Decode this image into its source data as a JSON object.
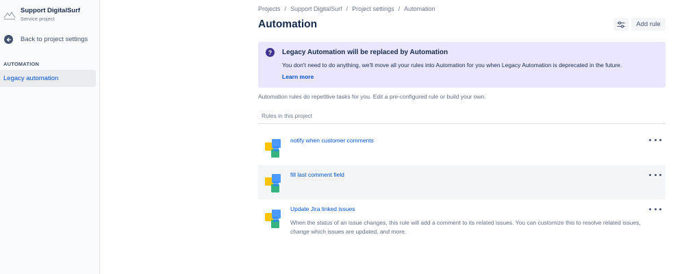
{
  "sidebar": {
    "project_name": "Support DigitalSurf",
    "project_type": "Service project",
    "back_label": "Back to project settings",
    "section_label": "AUTOMATION",
    "items": [
      {
        "label": "Legacy automation",
        "selected": true
      }
    ]
  },
  "breadcrumb": [
    {
      "label": "Projects"
    },
    {
      "label": "Support DigitalSurf"
    },
    {
      "label": "Project settings"
    },
    {
      "label": "Automation"
    }
  ],
  "breadcrumb_separator": "/",
  "header": {
    "title": "Automation",
    "filter_icon": "sliders-icon",
    "add_rule_label": "Add rule"
  },
  "banner": {
    "icon": "question-circle-icon",
    "title": "Legacy Automation will be replaced by Automation",
    "body": "You don't need to do anything, we'll move all your rules into Automation for you when Legacy Automation is deprecated in the future.",
    "link_label": "Learn more",
    "background": "#eae6ff"
  },
  "intro_text": "Automation rules do repetitive tasks for you. Edit a pre-configured rule or build your own.",
  "rules_header": "Rules in this project",
  "rules": [
    {
      "name": "notify when customer comments",
      "description": "",
      "icon": "cubes-icon"
    },
    {
      "name": "fill last comment field",
      "description": "",
      "icon": "cubes-icon"
    },
    {
      "name": "Update Jira linked issues",
      "description": "When the status of an issue changes, this rule will add a comment to its related issues. You can customize this to resolve related issues, change which issues are updated, and more.",
      "icon": "cubes-icon"
    }
  ],
  "colors": {
    "link": "#0052cc",
    "text": "#172b4d",
    "subtle": "#6b778c"
  }
}
